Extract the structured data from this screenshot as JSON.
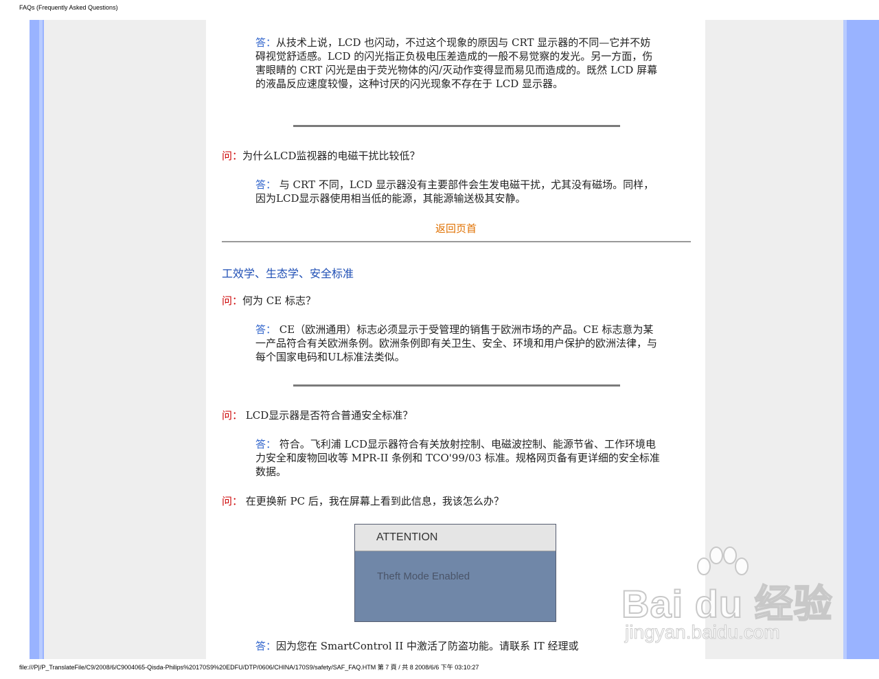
{
  "page": {
    "header": "FAQs (Frequently Asked Questions)",
    "footer": "file:///P|/P_TranslateFile/C9/2008/6/C9004065-Qisda-Philips%20170S9%20EDFU/DTP/0606/CHINA/170S9/safety/SAF_FAQ.HTM 第 7 頁 / 共 8 2008/6/6 下午 03:10:27"
  },
  "labels": {
    "answer": "答：",
    "question": "问："
  },
  "qa": {
    "a1_text": "从技术上说，LCD 也闪动，不过这个现象的原因与 CRT 显示器的不同—它并不妨碍视觉舒适感。LCD 的闪光指正负极电压差造成的一般不易觉察的发光。另一方面，伤害眼睛的 CRT 闪光是由于荧光物体的闪/灭动作变得显而易见而造成的。既然 LCD 屏幕的液晶反应速度较慢，这种讨厌的闪光现象不存在于 LCD 显示器。",
    "q2_text": "为什么LCD监视器的电磁干扰比较低？",
    "a2_text": " 与 CRT 不同，LCD 显示器没有主要部件会生发电磁干扰，尤其没有磁场。同样，因为LCD显示器使用相当低的能源，其能源输送极其安静。",
    "back_to_top": "返回页首",
    "section_title": "工效学、生态学、安全标准",
    "q3_text": "何为 CE 标志？",
    "a3_text": " CE（欧洲通用）标志必须显示于受管理的销售于欧洲市场的产品。CE 标志意为某一产品符合有关欧洲条例。欧洲条例即有关卫生、安全、环境和用户保护的欧洲法律，与每个国家电码和UL标准法类似。",
    "q4_label": "问： ",
    "q4_text": "LCD显示器是否符合普通安全标准？",
    "a4_text": " 符合。飞利浦 LCD显示器符合有关放射控制、电磁波控制、能源节省、工作环境电力安全和废物回收等 MPR-II 条例和 TCO'99/03 标准。规格网页备有更详细的安全标准数据。",
    "q5_label": "问： ",
    "q5_text": "在更换新 PC 后，我在屏幕上看到此信息，我该怎么办？",
    "a5_text": "因为您在 SmartControl II 中激活了防盗功能。请联系 IT 经理或"
  },
  "dialog": {
    "title": "ATTENTION",
    "message": "Theft Mode Enabled"
  },
  "watermark": {
    "brand": "Bai du 经验",
    "url": "jingyan.baidu.com"
  }
}
